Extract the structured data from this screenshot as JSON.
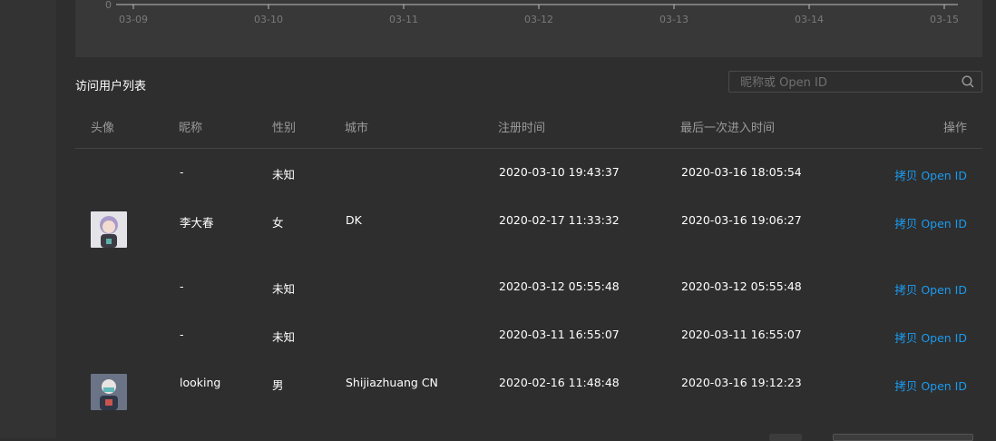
{
  "chart_data": {
    "type": "line",
    "x_ticks": [
      "03-09",
      "03-10",
      "03-11",
      "03-12",
      "03-13",
      "03-14",
      "03-15"
    ],
    "y_ticks": [
      "0"
    ],
    "grid": false
  },
  "user_list": {
    "title": "访问用户列表",
    "search_placeholder": "昵称或 Open ID",
    "columns": {
      "avatar": "头像",
      "nickname": "昵称",
      "gender": "性别",
      "city": "城市",
      "register_time": "注册时间",
      "last_enter_time": "最后一次进入时间",
      "action": "操作"
    },
    "rows": [
      {
        "nickname": "-",
        "gender": "未知",
        "city": "",
        "register_time": "2020-03-10 19:43:37",
        "last_enter_time": "2020-03-16 18:05:54",
        "action": "拷贝 Open ID",
        "avatar": "none"
      },
      {
        "nickname": "李大春",
        "gender": "女",
        "city": "DK",
        "register_time": "2020-02-17 11:33:32",
        "last_enter_time": "2020-03-16 19:06:27",
        "action": "拷贝 Open ID",
        "avatar": "user-photo"
      },
      {
        "nickname": "-",
        "gender": "未知",
        "city": "",
        "register_time": "2020-03-12 05:55:48",
        "last_enter_time": "2020-03-12 05:55:48",
        "action": "拷贝 Open ID",
        "avatar": "none"
      },
      {
        "nickname": "-",
        "gender": "未知",
        "city": "",
        "register_time": "2020-03-11 16:55:07",
        "last_enter_time": "2020-03-11 16:55:07",
        "action": "拷贝 Open ID",
        "avatar": "none"
      },
      {
        "nickname": "looking",
        "gender": "男",
        "city": "Shijiazhuang CN",
        "register_time": "2020-02-16 11:48:48",
        "last_enter_time": "2020-03-16 19:12:23",
        "action": "拷贝 Open ID",
        "avatar": "user-photo"
      }
    ]
  },
  "colors": {
    "link": "#1a9bf0",
    "background": "#2e2e2e",
    "panel": "#383838"
  }
}
